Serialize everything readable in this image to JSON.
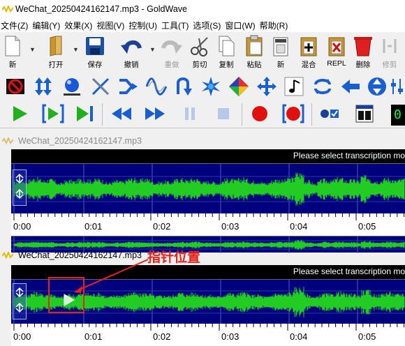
{
  "window": {
    "title": "WeChat_20250424162147.mp3 - GoldWave"
  },
  "menu": [
    "文件(Z)",
    "编辑(Y)",
    "效果(X)",
    "视图(V)",
    "控制(U)",
    "工具(T)",
    "选项(S)",
    "窗口(W)",
    "帮助(R)"
  ],
  "toolbar_main": {
    "new": "新",
    "open": "打开",
    "save": "保存",
    "undo": "撤销",
    "redo": "重做",
    "cut": "剪切",
    "copy": "复制",
    "paste": "粘贴",
    "paste_new": "新",
    "mix": "混合",
    "replace": "REPL",
    "delete": "删除",
    "trim": "修剪"
  },
  "counter_display": "0",
  "documents": [
    {
      "name": "WeChat_20250424162147.mp3",
      "status": "Please select transcription mo",
      "time_ticks": [
        "0:00",
        "0:01",
        "0:02",
        "0:03",
        "0:04",
        "0:05"
      ],
      "active": false
    },
    {
      "name": "WeChat_20250424162147.mp3",
      "status": "Please select transcription mo",
      "time_ticks": [
        "0:00",
        "0:01",
        "0:02",
        "0:03",
        "0:04",
        "0:05"
      ],
      "active": true
    }
  ],
  "annotation": {
    "text": "指针位置"
  },
  "colors": {
    "waveform_bg": "#00007f",
    "waveform": "#22cc22",
    "annotation": "#e8221a",
    "counter_text": "#00ff40"
  }
}
